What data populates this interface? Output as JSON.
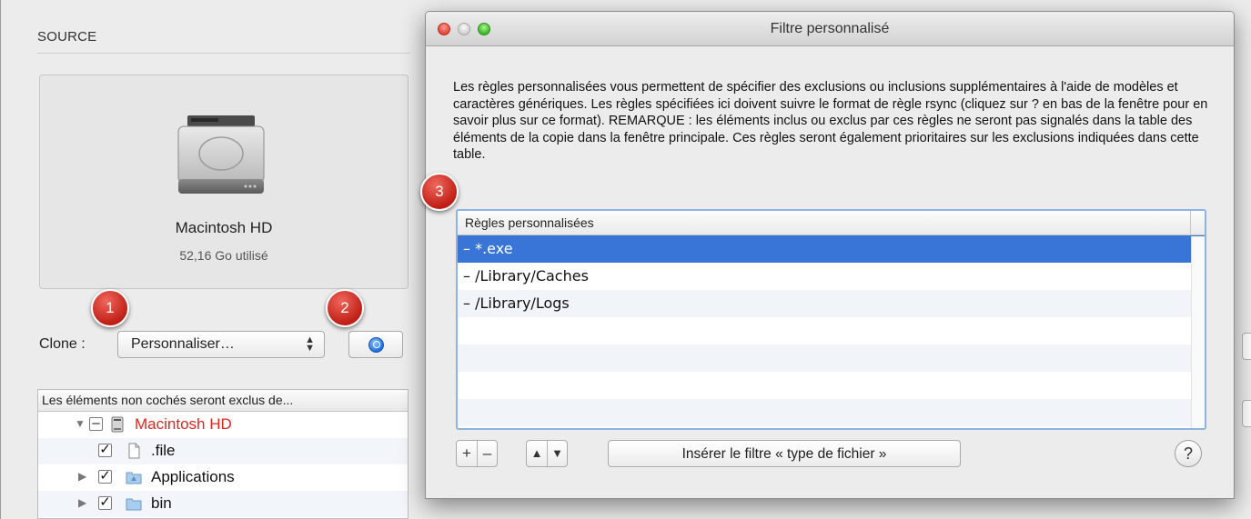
{
  "source": {
    "header": "SOURCE",
    "disk_name": "Macintosh HD",
    "disk_usage": "52,16 Go utilisé",
    "clone_label": "Clone :",
    "clone_value": "Personnaliser…",
    "tree_header": "Les éléments non cochés seront exclus de...",
    "tree_items": [
      {
        "label": "Macintosh HD",
        "checkbox": "–",
        "color": "#e0261d"
      },
      {
        "label": ".file",
        "checkbox": "✓"
      },
      {
        "label": "Applications",
        "checkbox": "✓"
      },
      {
        "label": "bin",
        "checkbox": "✓"
      }
    ]
  },
  "sheet": {
    "title": "Filtre personnalisé",
    "description": "Les règles personnalisées vous permettent de spécifier des exclusions ou inclusions supplémentaires à l'aide de modèles et caractères génériques. Les règles spécifiées ici doivent suivre le format de règle rsync (cliquez sur ? en bas de la fenêtre pour en savoir plus sur ce format). REMARQUE : les éléments inclus ou exclus par ces règles ne seront pas signalés dans la table des éléments de la copie dans la fenêtre principale. Ces règles seront également prioritaires sur les exclusions indiquées dans cette table.",
    "table_header": "Règles personnalisées",
    "rules": [
      "– *.exe",
      "– /Library/Caches",
      "– /Library/Logs"
    ],
    "add_label": "+",
    "remove_label": "–",
    "up_label": "▲",
    "down_label": "▼",
    "insert_button": "Insérer le filtre « type de fichier »",
    "help_label": "?"
  },
  "callouts": [
    "1",
    "2",
    "3"
  ],
  "colors": {
    "selection": "#3875d7",
    "badge": "#c01f17",
    "root_label": "#e0261d"
  }
}
